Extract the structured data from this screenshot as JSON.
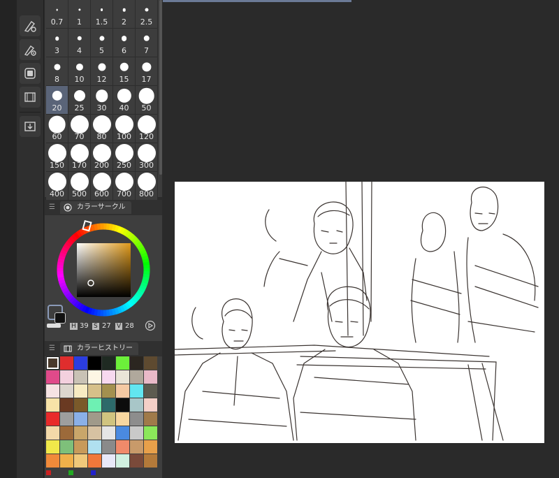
{
  "brush_size": {
    "sizes": [
      "0.7",
      "1",
      "1.5",
      "2",
      "2.5",
      "3",
      "4",
      "5",
      "6",
      "7",
      "8",
      "10",
      "12",
      "15",
      "17",
      "20",
      "25",
      "30",
      "40",
      "50",
      "60",
      "70",
      "80",
      "100",
      "120",
      "150",
      "170",
      "200",
      "250",
      "300",
      "400",
      "500",
      "600",
      "700",
      "800"
    ],
    "selected": "20"
  },
  "color_circle": {
    "tab_label": "カラーサークル",
    "h_label": "H",
    "h_value": "39",
    "s_label": "S",
    "s_value": "27",
    "v_label": "V",
    "v_value": "28",
    "main_color": "#473c2f"
  },
  "color_history": {
    "tab_label": "カラーヒストリー",
    "swatches": [
      "#4a3a2c",
      "#e02d2d",
      "#2b3de0",
      "#000000",
      "#1f2a22",
      "#6cf03a",
      "#2b2620",
      "#5e4a30",
      "#e04a8a",
      "#f3d0de",
      "#c9c2b5",
      "#fdf6e4",
      "#f7d9ef",
      "#e9e4d7",
      "#b0a89c",
      "#e9b9c8",
      "#f6e3e3",
      "#dcd6ce",
      "#f7ebc2",
      "#d6c089",
      "#a3904f",
      "#f4c9a3",
      "#62e6f0",
      "#5d5b50",
      "#f7e3a8",
      "#6a3a22",
      "#7a5a2a",
      "#6ef0b3",
      "#2d6a6a",
      "#0c0c0c",
      "#a8c6c8",
      "#f3cfc7",
      "#e82a2a",
      "#9e9e9e",
      "#8ab0e8",
      "#a09a8a",
      "#d0c480",
      "#f7d7a0",
      "#8d8d8d",
      "#a07a4a",
      "#f3d9a9",
      "#9c6a3a",
      "#c9a66a",
      "#d7c2a2",
      "#e5e5e5",
      "#4a8ae0",
      "#c9c9c9",
      "#8be85a",
      "#f0e84a",
      "#7ec07a",
      "#c89a5a",
      "#b0e0f0",
      "#8a8a8a",
      "#f08a6a",
      "#c89a6a",
      "#e8a04a",
      "#f08a3a",
      "#f0b04a",
      "#f0c87a",
      "#f0783a",
      "#e8e8f8",
      "#d0f0e0",
      "#7a4a3a",
      "#b47a3a"
    ],
    "selected_index": 0,
    "recent_markers": [
      "#cc2222",
      "#22aa22",
      "#2222cc"
    ]
  },
  "toolbar": {
    "icons": [
      "pen-settings-icon",
      "pen-target-icon",
      "layer-icon",
      "filmstrip-icon",
      "import-icon"
    ]
  }
}
